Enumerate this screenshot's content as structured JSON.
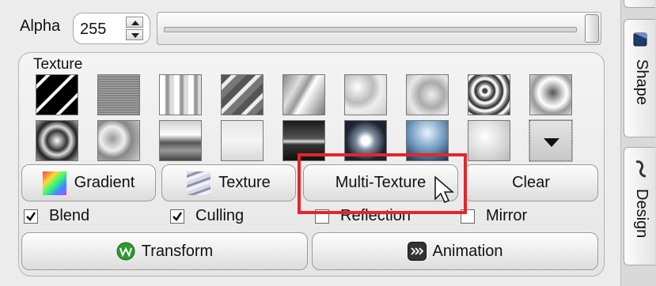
{
  "alpha": {
    "label": "Alpha",
    "value": "255",
    "slider_fraction": 1.0
  },
  "texture_group": {
    "title": "Texture",
    "thumbnails": [
      "diagonal-stripes-dark",
      "noise-gray",
      "vertical-streaks",
      "diagonal-stripes-light",
      "light-rays",
      "water-ripple",
      "water-ripple-2",
      "crumpled-metal",
      "liquid-metal",
      "marble-swirl",
      "caustics",
      "sky-clouds",
      "fog-gradient",
      "night-horizon",
      "glow-orb",
      "blue-sky",
      "soft-glow",
      "more-dropdown"
    ]
  },
  "buttons": {
    "gradient": "Gradient",
    "texture": "Texture",
    "multi_texture": "Multi-Texture",
    "clear": "Clear",
    "transform": "Transform",
    "animation": "Animation"
  },
  "checkboxes": {
    "blend": {
      "label": "Blend",
      "checked": true
    },
    "culling": {
      "label": "Culling",
      "checked": true
    },
    "reflection": {
      "label": "Reflection",
      "checked": false
    },
    "mirror": {
      "label": "Mirror",
      "checked": false
    }
  },
  "side_tabs": {
    "shape": "Shape",
    "design": "Design"
  },
  "colors": {
    "highlight": "#e3262b",
    "panel": "#ececec"
  }
}
